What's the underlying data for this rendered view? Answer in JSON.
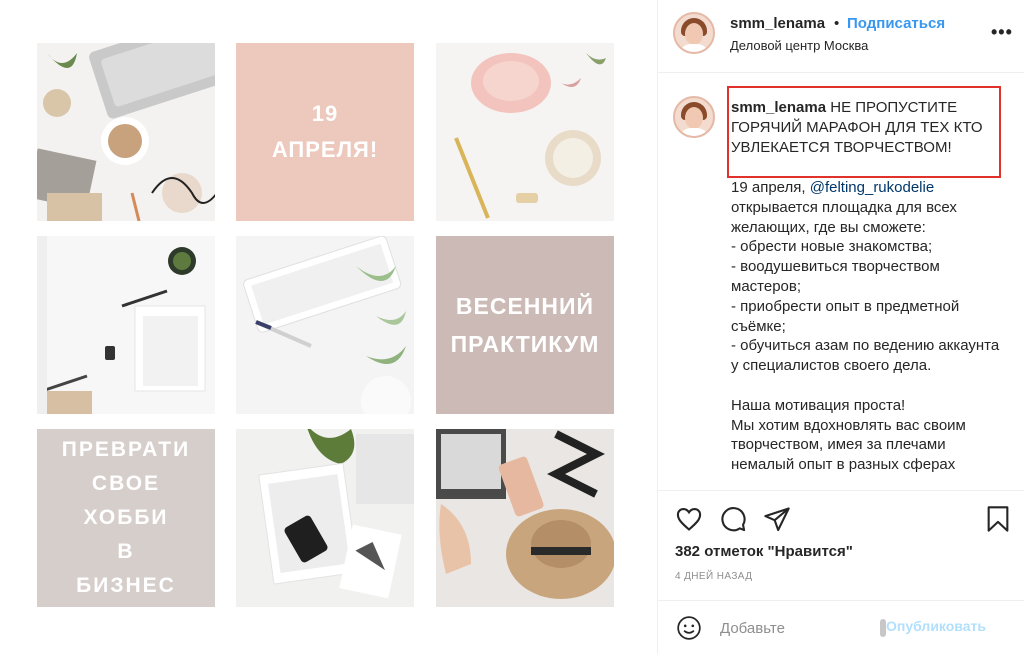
{
  "header": {
    "username": "smm_lenama",
    "separator": "•",
    "follow_label": "Подписаться",
    "location": "Деловой центр Москва",
    "more_label": "•••"
  },
  "grid": {
    "tile2_text": "19\nАПРЕЛЯ!",
    "tile6_text": "ВЕСЕННИЙ\nПРАКТИКУМ",
    "tile7_text": "ПРЕВРАТИ\nСВОЕ\nХОББИ\nВ\nБИЗНЕС"
  },
  "post": {
    "author": "smm_lenama",
    "caption_head": "НЕ ПРОПУСТИТЕ ГОРЯЧИЙ МАРАФОН ДЛЯ ТЕХ КТО УВЛЕКАЕТСЯ ТВОРЧЕСТВОМ!",
    "body_prefix": "19 апреля, ",
    "mention": "@felting_rukodelie",
    "body_rest": "\nоткрывается площадка для всех желающих, где вы сможете:\n- обрести новые знакомства;\n- воодушевиться творчеством мастеров;\n- приобрести опыт в предметной съёмке;\n- обучиться азам по ведению аккаунта у специалистов своего дела.\n\nНаша мотивация проста!\nМы хотим вдохновлять вас своим творчеством, имея за плечами немалый опыт в разных сферах"
  },
  "actions": {
    "likes": "382 отметок \"Нравится\"",
    "time_ago": "4 ДНЕЙ НАЗАД"
  },
  "comment_box": {
    "placeholder": "Добавьте",
    "publish_label": "Опубликовать"
  },
  "colors": {
    "follow_blue": "#3897f0",
    "highlight_red": "#e0322b",
    "publish_disabled": "#b2dffc"
  }
}
